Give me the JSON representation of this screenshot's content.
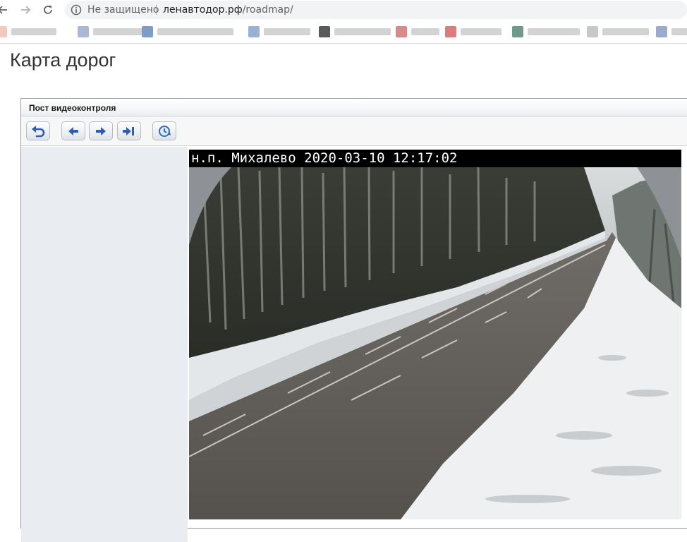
{
  "browser": {
    "security_label": "Не защищено",
    "url_host": "ленавтодор.рф",
    "url_path": "/roadmap/",
    "icons": [
      "back-arrow-icon",
      "forward-arrow-icon",
      "reload-icon",
      "info-icon"
    ]
  },
  "bookmarks": [
    {
      "color": "#f3c9bd"
    },
    {
      "color": "#aab8d6"
    },
    {
      "color": "#7f9cc7"
    },
    {
      "color": "#9bb0d6"
    },
    {
      "color": "#5a5a5a"
    },
    {
      "color": "#d98a8a"
    },
    {
      "color": "#d97d7d"
    },
    {
      "color": "#6e9a8e"
    },
    {
      "color": "#c8c8c8"
    },
    {
      "color": "#9aaad0"
    }
  ],
  "page": {
    "title": "Карта дорог"
  },
  "panel": {
    "title": "Пост видеоконтроля",
    "toolbar": {
      "buttons": [
        {
          "icon": "undo-icon"
        },
        {
          "icon": "arrow-left-icon"
        },
        {
          "icon": "arrow-right-icon"
        },
        {
          "icon": "skip-to-end-icon"
        },
        {
          "icon": "clock-refresh-icon"
        }
      ]
    }
  },
  "camera": {
    "overlay_text": "н.п. Михалево 2020-03-10 12:17:02"
  }
}
